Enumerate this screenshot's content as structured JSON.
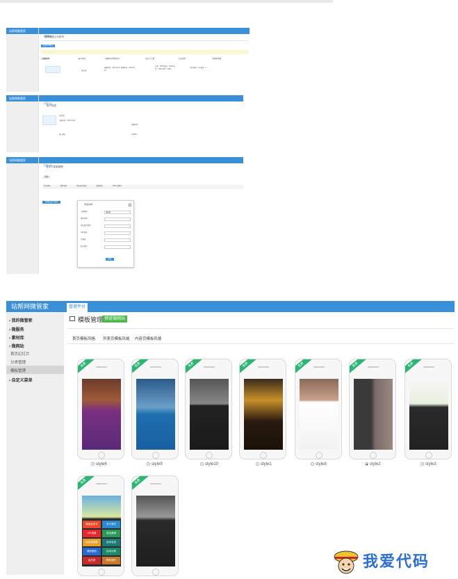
{
  "brand": "站帮网微管家",
  "top_tab": "管理平台",
  "panel1": {
    "title": "管理微信公众帐号",
    "add_button": "添加公众帐号",
    "notice": "温馨提示：",
    "columns": [
      "公众号名称",
      "帐号类型",
      "创建时间/到期时间",
      "已定义/上限",
      "会员请求",
      "请求数/限制"
    ],
    "row": {
      "type": "未认证",
      "dates": "创建时间：2015-01-27 到期时间：2016-01-24",
      "quota": "文本：0/200 图文：0/200 语音：0/200 LBS：0/200",
      "requests": "本月请求：0 总请求：0"
    }
  },
  "panel2": {
    "title": "用户信息",
    "fields": {
      "account": "会员组",
      "reg": "注册时间：2015-01-24",
      "expire": "到期时间：",
      "api": "接口地址",
      "token": "TOKEN："
    }
  },
  "panel3": {
    "title": "自定义菜单管理",
    "add": "添加",
    "columns": [
      "显示顺序",
      "菜单名称",
      "响应动作类型",
      "链接地址",
      "URL/关键词"
    ],
    "publish": "生成自定义菜单",
    "dialog": {
      "title": "添加菜单",
      "labels": [
        "父级菜单：",
        "菜单名称：",
        "响应动作类型：",
        "URL地址：",
        "关键词：",
        "显示顺序："
      ],
      "select_value": "请选择",
      "submit": "保存"
    }
  },
  "panel4": {
    "brand": "站帮网微管家",
    "tab": "管理平台",
    "menu": [
      {
        "label": "我的微管家",
        "type": "menu"
      },
      {
        "label": "微服务",
        "type": "menu"
      },
      {
        "label": "素材库",
        "type": "menu"
      },
      {
        "label": "微网站",
        "type": "menu"
      },
      {
        "label": "首页幻灯片",
        "type": "sub"
      },
      {
        "label": "分类管理",
        "type": "sub"
      },
      {
        "label": "模板管理",
        "type": "sub"
      },
      {
        "label": "自定义菜单",
        "type": "menu"
      }
    ],
    "page_title": "模板管理",
    "preview_badge": "预览微网站",
    "tabs": [
      "首页模板风格",
      "列表页模板风格",
      "内容页模板风格"
    ],
    "ribbon": "免费",
    "templates": [
      {
        "name": "style6",
        "checked": false
      },
      {
        "name": "style9",
        "checked": false
      },
      {
        "name": "style10",
        "checked": false
      },
      {
        "name": "style1",
        "checked": false
      },
      {
        "name": "style8",
        "checked": false
      },
      {
        "name": "style2",
        "checked": true
      },
      {
        "name": "style3",
        "checked": false
      },
      {
        "name": "style11",
        "checked": false
      },
      {
        "name": "style12",
        "checked": false
      }
    ],
    "style11_cells": [
      "微信会员卡",
      "关于我们",
      "VIP资源",
      "成功案例",
      "创业新观察",
      "技术支持",
      "我的服务",
      "技术分享",
      "会员秀",
      "联系我们"
    ]
  },
  "watermark": "我爱代码",
  "colors": {
    "accent": "#3a8fd9",
    "green": "#4cb84c",
    "ribbon": "#2bb673"
  }
}
